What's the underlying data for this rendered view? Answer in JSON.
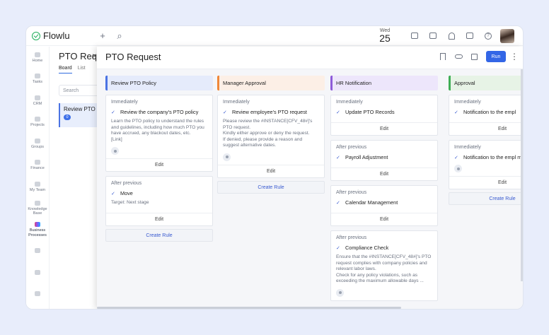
{
  "app": {
    "name": "Flowlu",
    "date_dow": "Wed",
    "date_day": "25"
  },
  "rail": [
    {
      "label": "Home"
    },
    {
      "label": "Tasks"
    },
    {
      "label": "CRM"
    },
    {
      "label": "Projects"
    },
    {
      "label": "Groups"
    },
    {
      "label": "Finance"
    },
    {
      "label": "My Team"
    },
    {
      "label": "Knowledge Base"
    },
    {
      "label": "Business Processes"
    },
    {
      "label": ""
    },
    {
      "label": ""
    },
    {
      "label": ""
    }
  ],
  "bg": {
    "title": "PTO Req",
    "tab_board": "Board",
    "tab_list": "List",
    "search_placeholder": "Search",
    "card_title": "Review PTO",
    "card_count": "0"
  },
  "modal": {
    "title": "PTO Request",
    "run_label": "Run",
    "close": "×"
  },
  "columns": [
    {
      "title": "Review PTO Policy",
      "accent": "#4b73e3",
      "bg": "#e5ebfb",
      "cards": [
        {
          "trigger": "Immediately",
          "action": "Review the company's PTO policy",
          "desc": "Learn the PTO policy to understand the rules and guidelines, including how much PTO you have accrued, any blackout dates, etc.\n[Link]",
          "assignee": true,
          "edit": "Edit"
        },
        {
          "trigger": "After previous",
          "action": "Move",
          "desc": "Target: Next stage",
          "assignee": false,
          "edit": "Edit"
        }
      ],
      "create": "Create Rule"
    },
    {
      "title": "Manager Approval",
      "accent": "#f0883a",
      "bg": "#fcefe6",
      "cards": [
        {
          "trigger": "Immediately",
          "action": "Review employee's PTO request",
          "desc": "Please review the #INSTANCE[CFV_48#]'s PTO request.\nKindly either approve or deny the request.\nIf denied, please provide a reason and suggest alternative dates.",
          "assignee": true,
          "edit": "Edit"
        }
      ],
      "create": "Create Rule"
    },
    {
      "title": "HR Notification",
      "accent": "#8e5bd9",
      "bg": "#ede6fb",
      "cards": [
        {
          "trigger": "Immediately",
          "action": "Update PTO Records",
          "desc": "",
          "assignee": false,
          "edit": "Edit"
        },
        {
          "trigger": "After previous",
          "action": "Payroll Adjustment",
          "desc": "",
          "assignee": false,
          "edit": "Edit"
        },
        {
          "trigger": "After previous",
          "action": "Calendar Management",
          "desc": "",
          "assignee": false,
          "edit": "Edit"
        },
        {
          "trigger": "After previous",
          "action": "Compliance Check",
          "desc": "Ensure that the #INSTANCE[CFV_48#]'s PTO request complies with company policies and relevant labor laws.\nCheck for any policy violations, such as exceeding the maximum allowable days ...",
          "assignee": true,
          "edit": ""
        }
      ],
      "create": ""
    },
    {
      "title": "Approval",
      "accent": "#3fae55",
      "bg": "#e7f3e6",
      "cards": [
        {
          "trigger": "Immediately",
          "action": "Notification to the empl",
          "desc": "",
          "assignee": false,
          "edit": "Edit"
        },
        {
          "trigger": "Immediately",
          "action": "Notification to the empl manager",
          "desc": "",
          "assignee": true,
          "edit": "Edit"
        }
      ],
      "create": "Create Rule"
    }
  ]
}
